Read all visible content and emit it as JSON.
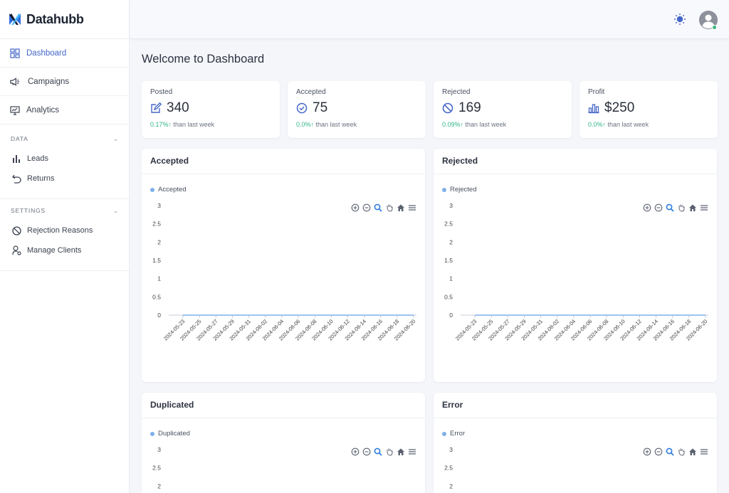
{
  "brand": {
    "name": "Datahubb"
  },
  "sidebar": {
    "items": [
      {
        "label": "Dashboard",
        "icon": "dashboard-icon"
      },
      {
        "label": "Campaigns",
        "icon": "megaphone-icon"
      },
      {
        "label": "Analytics",
        "icon": "monitor-icon"
      }
    ],
    "data_section": {
      "title": "DATA",
      "items": [
        {
          "label": "Leads",
          "icon": "bar-chart-icon"
        },
        {
          "label": "Returns",
          "icon": "undo-icon"
        }
      ]
    },
    "settings_section": {
      "title": "SETTINGS",
      "items": [
        {
          "label": "Rejection Reasons",
          "icon": "ban-icon"
        },
        {
          "label": "Manage Clients",
          "icon": "user-gear-icon"
        }
      ]
    }
  },
  "header": {
    "theme_icon": "sun-icon",
    "avatar_icon": "user-avatar-icon",
    "status_color": "#3ab87a"
  },
  "page": {
    "title": "Welcome to Dashboard"
  },
  "stats": [
    {
      "label": "Posted",
      "value": "340",
      "change": "0.17%",
      "arrow": "↑",
      "suffix": "than last week",
      "icon": "edit-square-icon"
    },
    {
      "label": "Accepted",
      "value": "75",
      "change": "0.0%",
      "arrow": "↑",
      "suffix": "than last week",
      "icon": "check-circle-icon"
    },
    {
      "label": "Rejected",
      "value": "169",
      "change": "0.09%",
      "arrow": "↑",
      "suffix": "than last week",
      "icon": "ban-icon"
    },
    {
      "label": "Profit",
      "value": "$250",
      "change": "0.0%",
      "arrow": "↑",
      "suffix": "than last week",
      "icon": "bar-chart-icon"
    }
  ],
  "colors": {
    "accent": "#4466c9",
    "positive": "#2fb38a",
    "series": "#7fb0ea"
  },
  "chart_data": [
    {
      "type": "line",
      "title": "Accepted",
      "series": [
        {
          "name": "Accepted",
          "values": [
            0,
            0,
            0,
            0,
            0,
            0,
            0,
            0,
            0,
            0,
            0,
            0,
            0,
            0,
            0
          ]
        }
      ],
      "x": [
        "2024-05-23",
        "2024-05-25",
        "2024-05-27",
        "2024-05-29",
        "2024-05-31",
        "2024-06-02",
        "2024-06-04",
        "2024-06-06",
        "2024-06-08",
        "2024-06-10",
        "2024-06-12",
        "2024-06-14",
        "2024-06-16",
        "2024-06-18",
        "2024-06-20"
      ],
      "yticks": [
        "3",
        "2.5",
        "2",
        "1.5",
        "1",
        "0.5",
        "0"
      ],
      "ylim": [
        0,
        3
      ],
      "legend": "top-left",
      "grid": false
    },
    {
      "type": "line",
      "title": "Rejected",
      "series": [
        {
          "name": "Rejected",
          "values": [
            0,
            0,
            0,
            0,
            0,
            0,
            0,
            0,
            0,
            0,
            0,
            0,
            0,
            0,
            0
          ]
        }
      ],
      "x": [
        "2024-05-23",
        "2024-05-25",
        "2024-05-27",
        "2024-05-29",
        "2024-05-31",
        "2024-06-02",
        "2024-06-04",
        "2024-06-06",
        "2024-06-08",
        "2024-06-10",
        "2024-06-12",
        "2024-06-14",
        "2024-06-16",
        "2024-06-18",
        "2024-06-20"
      ],
      "yticks": [
        "3",
        "2.5",
        "2",
        "1.5",
        "1",
        "0.5",
        "0"
      ],
      "ylim": [
        0,
        3
      ],
      "legend": "top-left",
      "grid": false
    },
    {
      "type": "line",
      "title": "Duplicated",
      "series": [
        {
          "name": "Duplicated",
          "values": []
        }
      ],
      "x": [],
      "yticks": [
        "3",
        "2.5",
        "2"
      ],
      "ylim": [
        0,
        3
      ],
      "legend": "top-left",
      "grid": false
    },
    {
      "type": "line",
      "title": "Error",
      "series": [
        {
          "name": "Error",
          "values": []
        }
      ],
      "x": [],
      "yticks": [
        "3",
        "2.5",
        "2"
      ],
      "ylim": [
        0,
        3
      ],
      "legend": "top-left",
      "grid": false
    }
  ],
  "chart_toolbar": [
    "zoom-in-icon",
    "zoom-out-icon",
    "search-zoom-icon",
    "pan-hand-icon",
    "home-icon",
    "menu-icon"
  ]
}
